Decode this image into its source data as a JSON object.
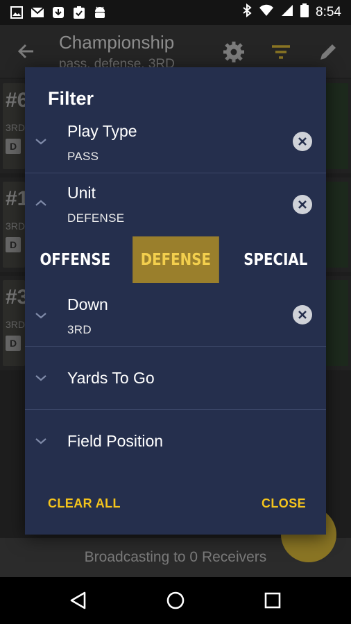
{
  "status_bar": {
    "time": "8:54",
    "icons": [
      "image-icon",
      "gmail-icon",
      "download-icon",
      "clipboard-check-icon",
      "android-icon",
      "bluetooth-icon",
      "wifi-icon",
      "signal-icon",
      "battery-icon"
    ]
  },
  "app_bar": {
    "title": "Championship",
    "subtitle": "pass, defense, 3RD"
  },
  "background_list": {
    "cards": [
      {
        "number": "#6",
        "down": "3RD",
        "badge": "D"
      },
      {
        "number": "#1",
        "down": "3RD",
        "badge": "D"
      },
      {
        "number": "#3",
        "down": "3RD",
        "badge": "D"
      }
    ]
  },
  "bottom_bar": {
    "text": "Broadcasting to 0 Receivers"
  },
  "dialog": {
    "title": "Filter",
    "filters": [
      {
        "label": "Play Type",
        "value": "PASS",
        "expanded": false
      },
      {
        "label": "Unit",
        "value": "DEFENSE",
        "expanded": true
      },
      {
        "label": "Down",
        "value": "3RD",
        "expanded": false
      },
      {
        "label": "Yards To Go",
        "value": "",
        "expanded": false
      },
      {
        "label": "Field Position",
        "value": "",
        "expanded": false
      }
    ],
    "unit_options": [
      "OFFENSE",
      "DEFENSE",
      "SPECIAL"
    ],
    "unit_selected": "DEFENSE",
    "clear_all_label": "CLEAR ALL",
    "close_label": "CLOSE"
  },
  "colors": {
    "dialog_bg": "#252f4d",
    "accent": "#f4c41c",
    "selected_segment": "#9a7f2c"
  }
}
